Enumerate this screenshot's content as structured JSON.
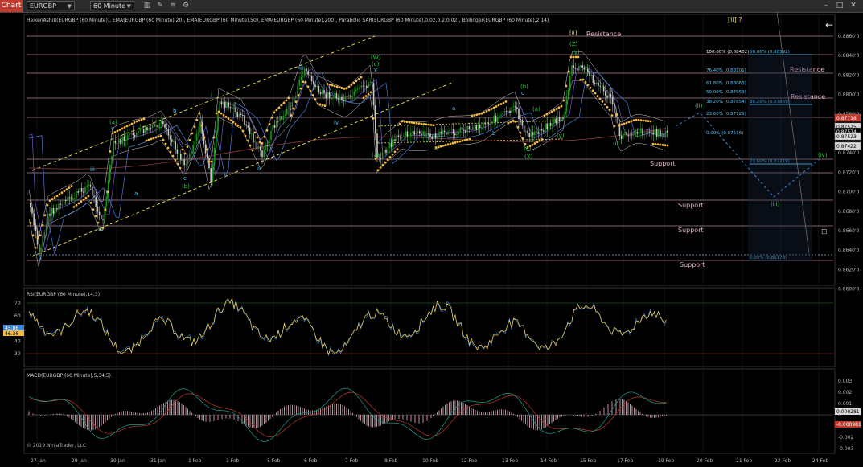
{
  "toolbar": {
    "tab_label": "Chart",
    "instrument": "EURGBP",
    "timeframe": "60 Minute",
    "icons": [
      "bar-style-icon",
      "drawing-tools-icon",
      "indicators-icon",
      "properties-icon"
    ]
  },
  "window_controls": [
    "minimize-icon",
    "maximize-icon",
    "close-icon"
  ],
  "chart": {
    "indicator_legend": "HeikenAshi8(EURGBP (60 Minute)), EMA(EURGBP (60 Minute),20), EMA(EURGBP (60 Minute),50), EMA(EURGBP (60 Minute),200), Parabolic SAR(EURGBP (60 Minute),0.02,0.2,0.02), Bollinger(EURGBP (60 Minute),2,14)",
    "top_wave_label": "[ii] ?",
    "copyright": "© 2019 NinjaTrader, LLC",
    "price_ticks": [
      "0.8860'0",
      "0.8840'0",
      "0.8820'0",
      "0.8800'0",
      "0.8780'0",
      "0.8760'0",
      "0.8740'0",
      "0.8720'0",
      "0.8700'0",
      "0.8680'0",
      "0.8660'0",
      "0.8640'0",
      "0.8620'0",
      "0.8600'0"
    ],
    "price_tags": [
      {
        "text": "0.87718",
        "color": "#c0392b"
      },
      {
        "text": "0.87525",
        "color": "#d9d9d9"
      },
      {
        "text": "0.87574",
        "color": "#000000"
      },
      {
        "text": "0.87523",
        "color": "#d9d9d9"
      },
      {
        "text": "0.87422",
        "color": "#d9d9d9"
      }
    ],
    "levels": [
      {
        "label": "Resistance"
      },
      {
        "label": "Resistance"
      },
      {
        "label": "Resistance"
      },
      {
        "label": "Support"
      },
      {
        "label": "Support"
      },
      {
        "label": "Support"
      },
      {
        "label": "Support"
      }
    ],
    "fib_left": [
      "100.00% (0.88402)",
      "76.40% (0.88101)",
      "61.80% (0.88063)",
      "50.00% (0.87959)",
      "38.20% (0.87854)",
      "23.60% (0.87725)",
      "0.00% (0.87516)"
    ],
    "fib_right": [
      "50.00% (0.88392)",
      "38.20% (0.87869)",
      "23.60% (0.87219)",
      "0.00% (0.86178)"
    ],
    "wave_labels": [
      "i",
      "ii",
      "iii",
      "iv",
      "v",
      "(a)",
      "(b)",
      "(c)",
      "(W)",
      "(X)",
      "(Z)",
      "(y)",
      "(ii)",
      "(iii)",
      "(iv)",
      "(i)",
      "a",
      "b",
      "c",
      "[ii]"
    ]
  },
  "rsi": {
    "title": "RSI(EURGBP (60 Minute),14,3)",
    "ticks": [
      "70",
      "60",
      "50",
      "40",
      "30"
    ],
    "tag_upper": "45.86",
    "tag_lower": "46.36"
  },
  "macd": {
    "title": "MACD(EURGBP (60 Minute),5,34,5)",
    "ticks": [
      "0.003",
      "0.002",
      "0.001",
      "0",
      "-0.001",
      "-0.002",
      "-0.003"
    ],
    "tag_upper": "0.000281",
    "tag_lower": "-0.000981"
  },
  "date_axis": [
    "27 Jan",
    "29 Jan",
    "30 Jan",
    "31 Jan",
    "1 Feb",
    "3 Feb",
    "5 Feb",
    "6 Feb",
    "7 Feb",
    "8 Feb",
    "10 Feb",
    "12 Feb",
    "13 Feb",
    "14 Feb",
    "15 Feb",
    "17 Feb",
    "19 Feb",
    "20 Feb",
    "21 Feb",
    "22 Feb",
    "24 Feb"
  ],
  "colors": {
    "sar": "#f5b942",
    "up_candle": "#1f8f1f",
    "down_candle": "#c8c8c8",
    "channel": "#e5d84a",
    "bollinger": "#cfcfcf",
    "rsi_line": "#ffd34d",
    "macd_line": "#1fa08f",
    "macd_signal": "#c0392b",
    "projection": "#3a86d8",
    "wave_green": "#2ecc40",
    "wave_cyan": "#4fc3f7",
    "level_line": "#e8b4c8"
  }
}
